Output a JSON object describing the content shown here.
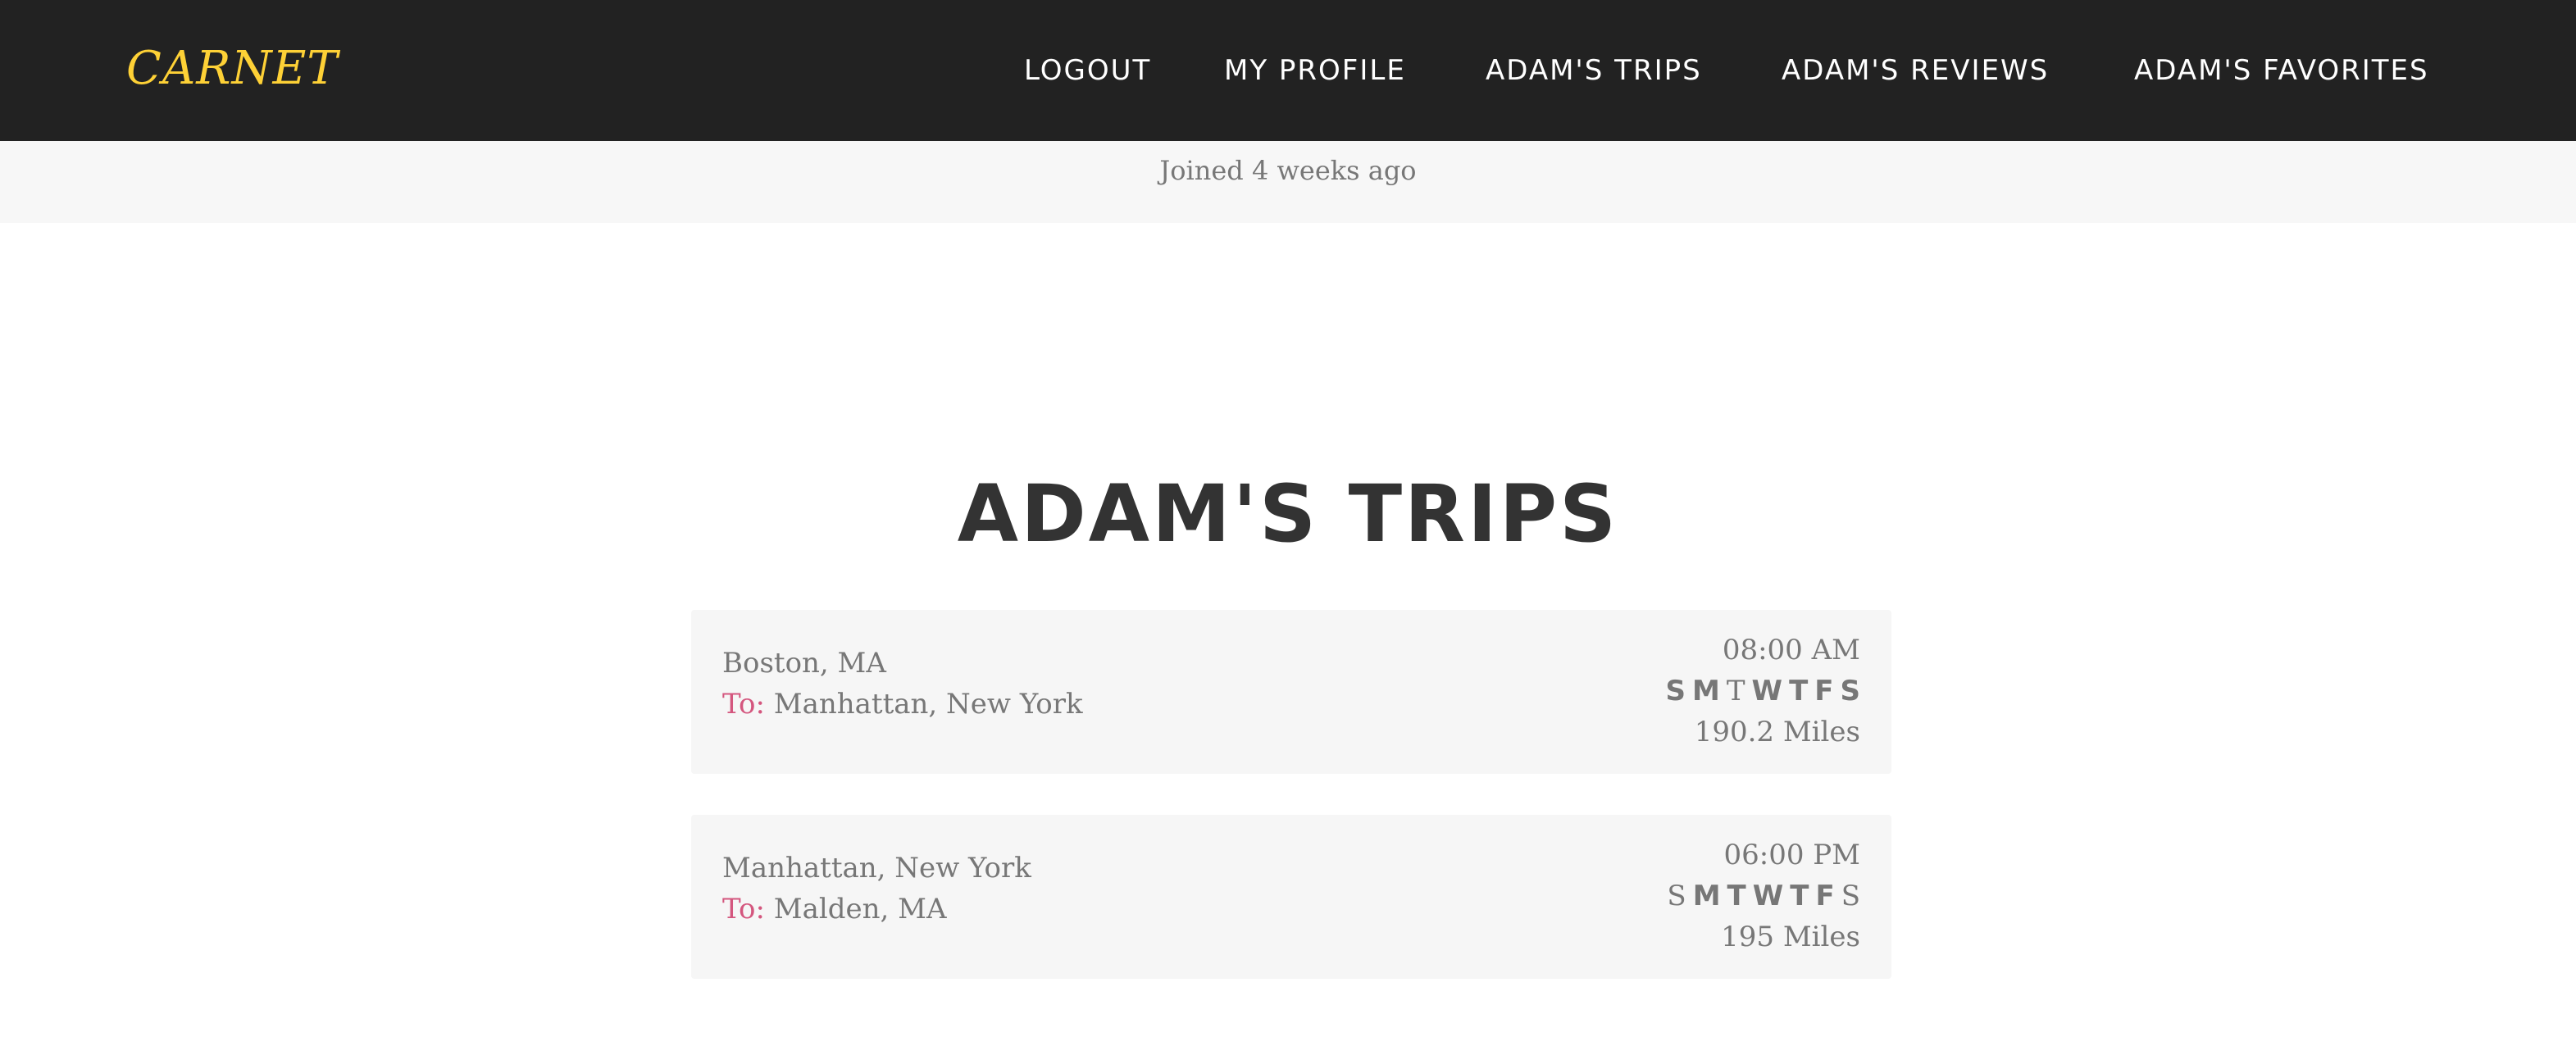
{
  "navbar": {
    "brand": "CARNET",
    "links": [
      {
        "label": "LOGOUT"
      },
      {
        "label": "MY PROFILE"
      },
      {
        "label": "ADAM'S TRIPS"
      },
      {
        "label": "ADAM'S REVIEWS"
      },
      {
        "label": "ADAM'S FAVORITES"
      }
    ]
  },
  "profile": {
    "joined": "Joined 4 weeks ago"
  },
  "main": {
    "title": "ADAM'S TRIPS",
    "to_label": "To:",
    "trips": [
      {
        "from": "Boston, MA",
        "to": "Manhattan, New York",
        "time": "08:00 AM",
        "days": [
          {
            "letter": "S",
            "active": true
          },
          {
            "letter": "M",
            "active": true
          },
          {
            "letter": "T",
            "active": false
          },
          {
            "letter": "W",
            "active": true
          },
          {
            "letter": "T",
            "active": true
          },
          {
            "letter": "F",
            "active": true
          },
          {
            "letter": "S",
            "active": true
          }
        ],
        "miles": "190.2 Miles"
      },
      {
        "from": "Manhattan, New York",
        "to": "Malden, MA",
        "time": "06:00 PM",
        "days": [
          {
            "letter": "S",
            "active": false
          },
          {
            "letter": "M",
            "active": true
          },
          {
            "letter": "T",
            "active": true
          },
          {
            "letter": "W",
            "active": true
          },
          {
            "letter": "T",
            "active": true
          },
          {
            "letter": "F",
            "active": true
          },
          {
            "letter": "S",
            "active": false
          }
        ],
        "miles": "195 Miles"
      }
    ]
  },
  "colors": {
    "navbar_bg": "#222222",
    "brand": "#fed136",
    "to_label": "#d4567e",
    "card_bg": "#f6f6f6",
    "text_muted": "#777777",
    "title": "#333333"
  }
}
